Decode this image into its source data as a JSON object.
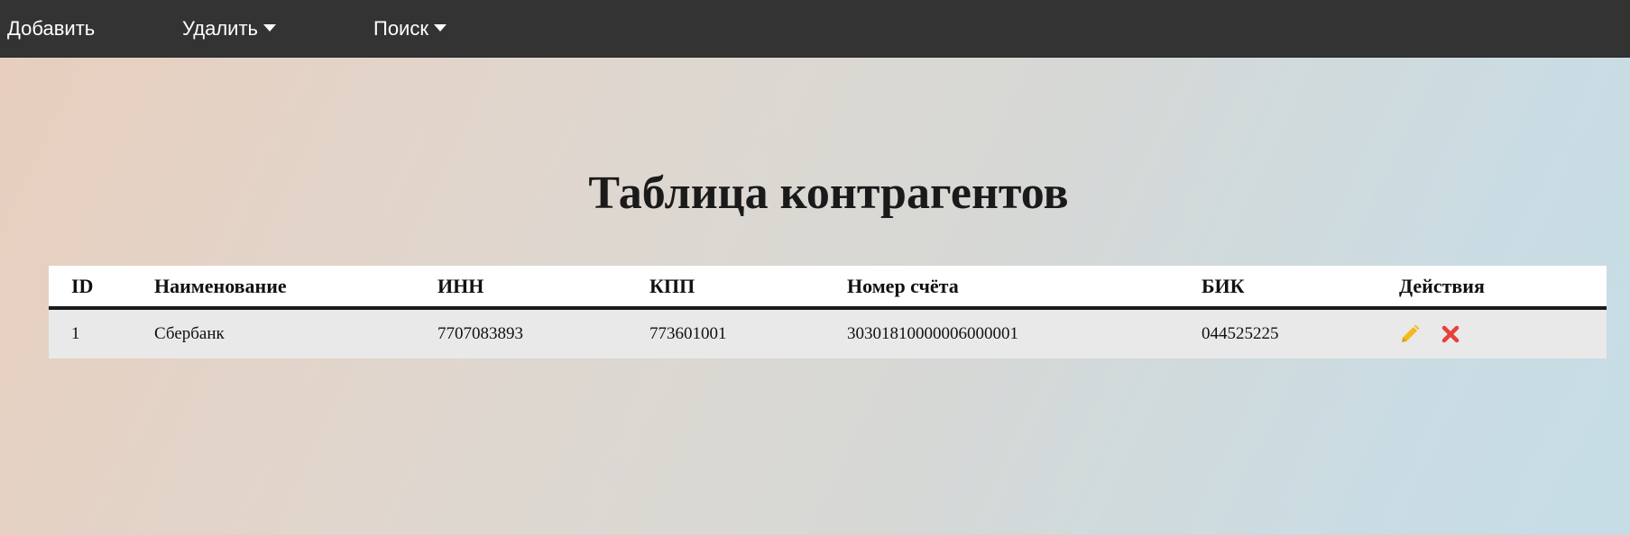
{
  "nav": {
    "add_label": "Добавить",
    "delete_label": "Удалить",
    "search_label": "Поиск"
  },
  "page": {
    "title": "Таблица контрагентов"
  },
  "table": {
    "headers": [
      "ID",
      "Наименование",
      "ИНН",
      "КПП",
      "Номер счёта",
      "БИК",
      "Действия"
    ],
    "rows": [
      {
        "id": "1",
        "name": "Сбербанк",
        "inn": "7707083893",
        "kpp": "773601001",
        "account": "30301810000006000001",
        "bik": "044525225",
        "actions": [
          "pencil-icon",
          "close-icon"
        ]
      }
    ]
  },
  "colors": {
    "navbar_bg": "#333333",
    "edit_icon": "#f6b81f",
    "delete_icon": "#e8403a",
    "header_row_bg": "#ffffff",
    "data_row_bg": "#e9e9e9"
  }
}
